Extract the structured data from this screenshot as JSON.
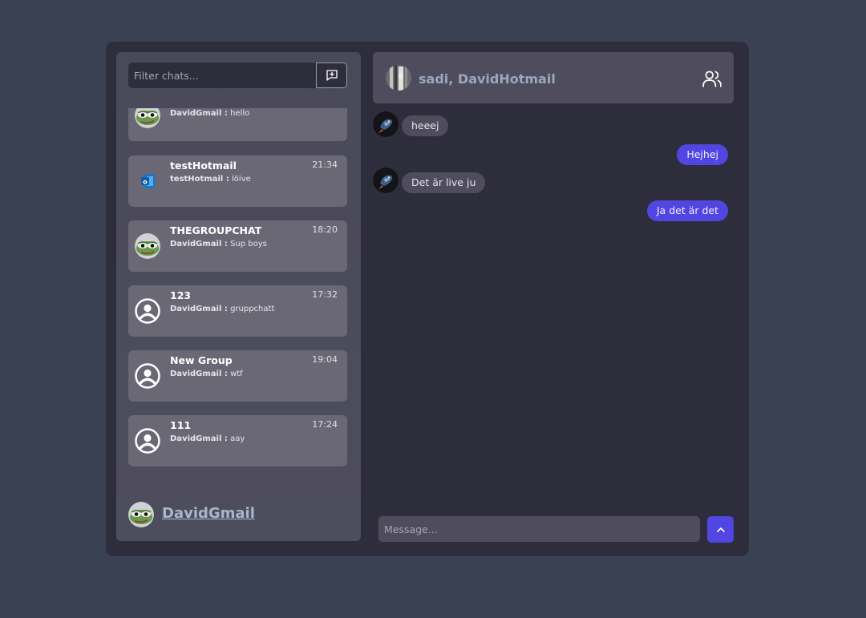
{
  "sidebar": {
    "filter_placeholder": "Filter chats...",
    "chats": [
      {
        "name": "",
        "preview_sender": "DavidGmail :",
        "preview_text": "hello",
        "time": ""
      },
      {
        "name": "testHotmail",
        "preview_sender": "testHotmail :",
        "preview_text": "löive",
        "time": "21:34"
      },
      {
        "name": "THEGROUPCHAT",
        "preview_sender": "DavidGmail :",
        "preview_text": "Sup boys",
        "time": "18:20"
      },
      {
        "name": "123",
        "preview_sender": "DavidGmail :",
        "preview_text": "gruppchatt",
        "time": "17:32"
      },
      {
        "name": "New Group",
        "preview_sender": "DavidGmail :",
        "preview_text": "wtf",
        "time": "19:04"
      },
      {
        "name": "111",
        "preview_sender": "DavidGmail :",
        "preview_text": "aay",
        "time": "17:24"
      }
    ],
    "current_user": "DavidGmail"
  },
  "conversation": {
    "title": "sadi, DavidHotmail",
    "messages": [
      {
        "direction": "in",
        "text": "heeej"
      },
      {
        "direction": "out",
        "text": "Hejhej"
      },
      {
        "direction": "in",
        "text": "Det är live ju"
      },
      {
        "direction": "out",
        "text": "Ja det är det"
      }
    ],
    "input_placeholder": "Message..."
  },
  "colors": {
    "page_background": "#394153",
    "panel_background": "#2e2d3c",
    "chat_item_background": "#6a6875",
    "accent": "#5146e2",
    "incoming_bubble": "#4f4d5d",
    "username_link": "#a9b6cc"
  },
  "icons": {
    "new_chat": "message-plus-icon",
    "members": "users-icon",
    "send": "chevron-up-icon",
    "pepe_avatar": "frog-avatar",
    "outlook_avatar": "outlook-logo",
    "default_avatar": "user-circle-icon"
  }
}
